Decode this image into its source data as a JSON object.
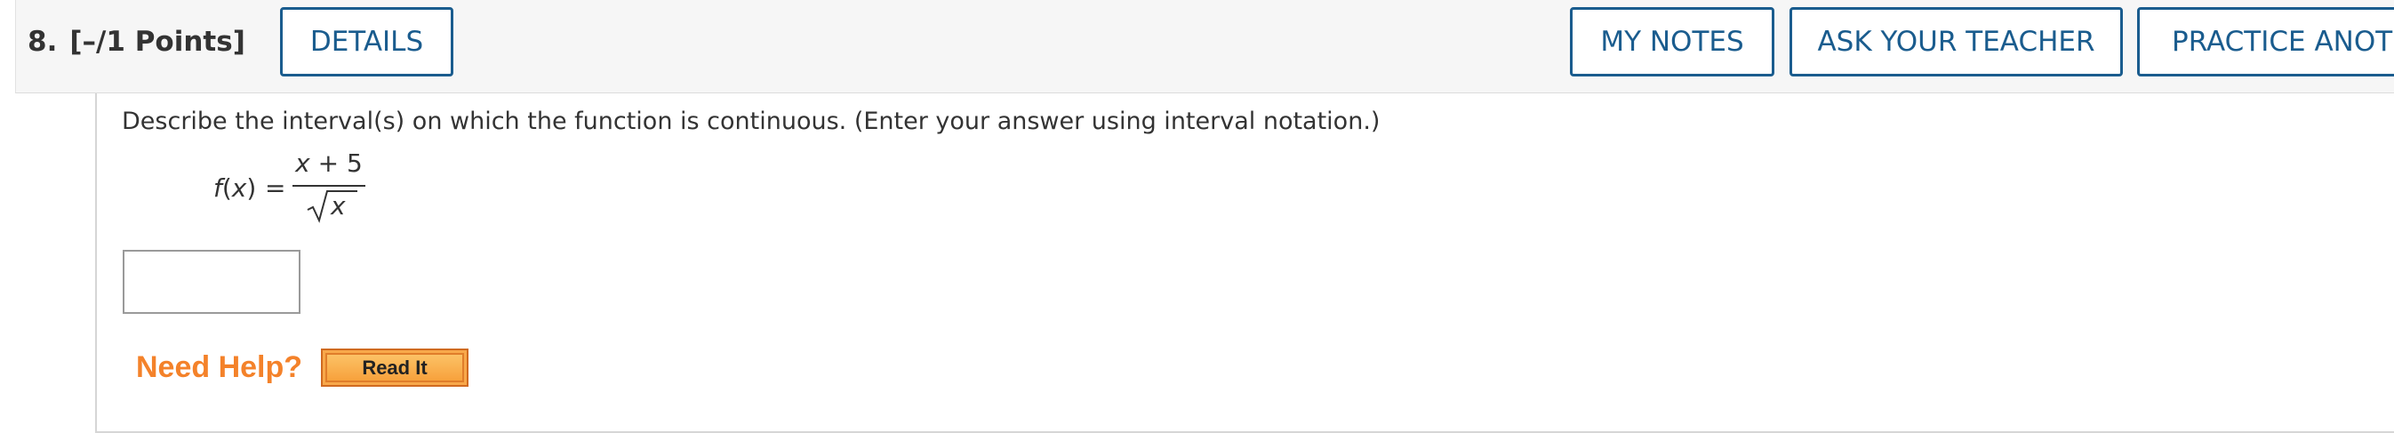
{
  "header": {
    "question_number": "8.",
    "points": "[–/1 Points]",
    "details_label": "DETAILS",
    "my_notes_label": "MY NOTES",
    "ask_teacher_label": "ASK YOUR TEACHER",
    "practice_label": "PRACTICE ANOTHER"
  },
  "question": {
    "prompt": "Describe the interval(s) on which the function is continuous. (Enter your answer using interval notation.)",
    "function_lhs_name": "f",
    "function_lhs_arg": "x",
    "equals": "=",
    "numerator_var": "x",
    "numerator_rest": " + 5",
    "denominator_var": "x"
  },
  "answer": {
    "value": "",
    "placeholder": ""
  },
  "help": {
    "need_help_label": "Need Help?",
    "read_it_label": "Read It"
  },
  "colors": {
    "accent": "#1a5c8e",
    "help_orange": "#f4822a",
    "read_it_bg": "#f8a84a",
    "header_bg": "#f6f6f6"
  }
}
